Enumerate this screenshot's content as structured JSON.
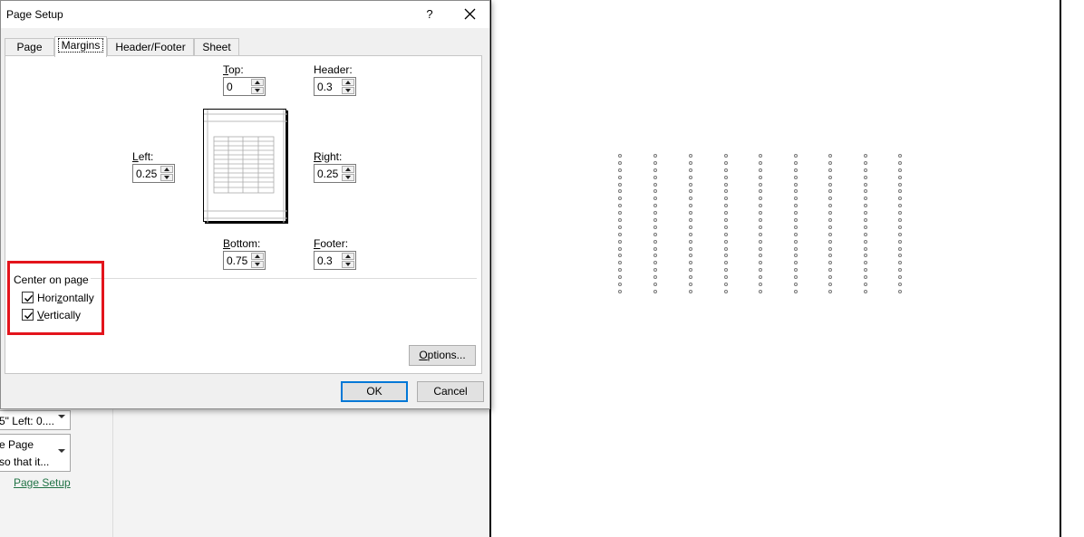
{
  "dialog": {
    "title": "Page Setup",
    "help_label": "?",
    "tabs": [
      {
        "label": "Page",
        "active": false
      },
      {
        "label": "Margins",
        "active": true
      },
      {
        "label": "Header/Footer",
        "active": false
      },
      {
        "label": "Sheet",
        "active": false
      }
    ],
    "margins": {
      "top": {
        "accel": "T",
        "rest": "op:",
        "value": "0"
      },
      "header": {
        "accel": "",
        "label": "Header:",
        "value": "0.3"
      },
      "left": {
        "accel": "L",
        "rest": "eft:",
        "value": "0.25"
      },
      "right": {
        "accel": "R",
        "rest": "ight:",
        "value": "0.25"
      },
      "bottom": {
        "accel": "B",
        "rest": "ottom:",
        "value": "0.75"
      },
      "footer": {
        "accel": "F",
        "rest": "ooter:",
        "value": "0.3"
      }
    },
    "center_on_page": {
      "label": "Center on page",
      "horizontally": {
        "pre": "Hori",
        "accel": "z",
        "post": "ontally",
        "checked": true
      },
      "vertically": {
        "pre": "",
        "accel": "V",
        "post": "ertically",
        "checked": true
      }
    },
    "options_button": {
      "accel": "O",
      "rest": "ptions..."
    },
    "ok_label": "OK",
    "cancel_label": "Cancel"
  },
  "backstage": {
    "margins_setting": "5\" Left: 0....",
    "scaling_setting_line1": "e Page",
    "scaling_setting_line2": "so that it...",
    "page_setup_link": "Page Setup"
  },
  "colors": {
    "highlight": "#e3141c",
    "link": "#217346",
    "default_button_border": "#0078d7"
  }
}
